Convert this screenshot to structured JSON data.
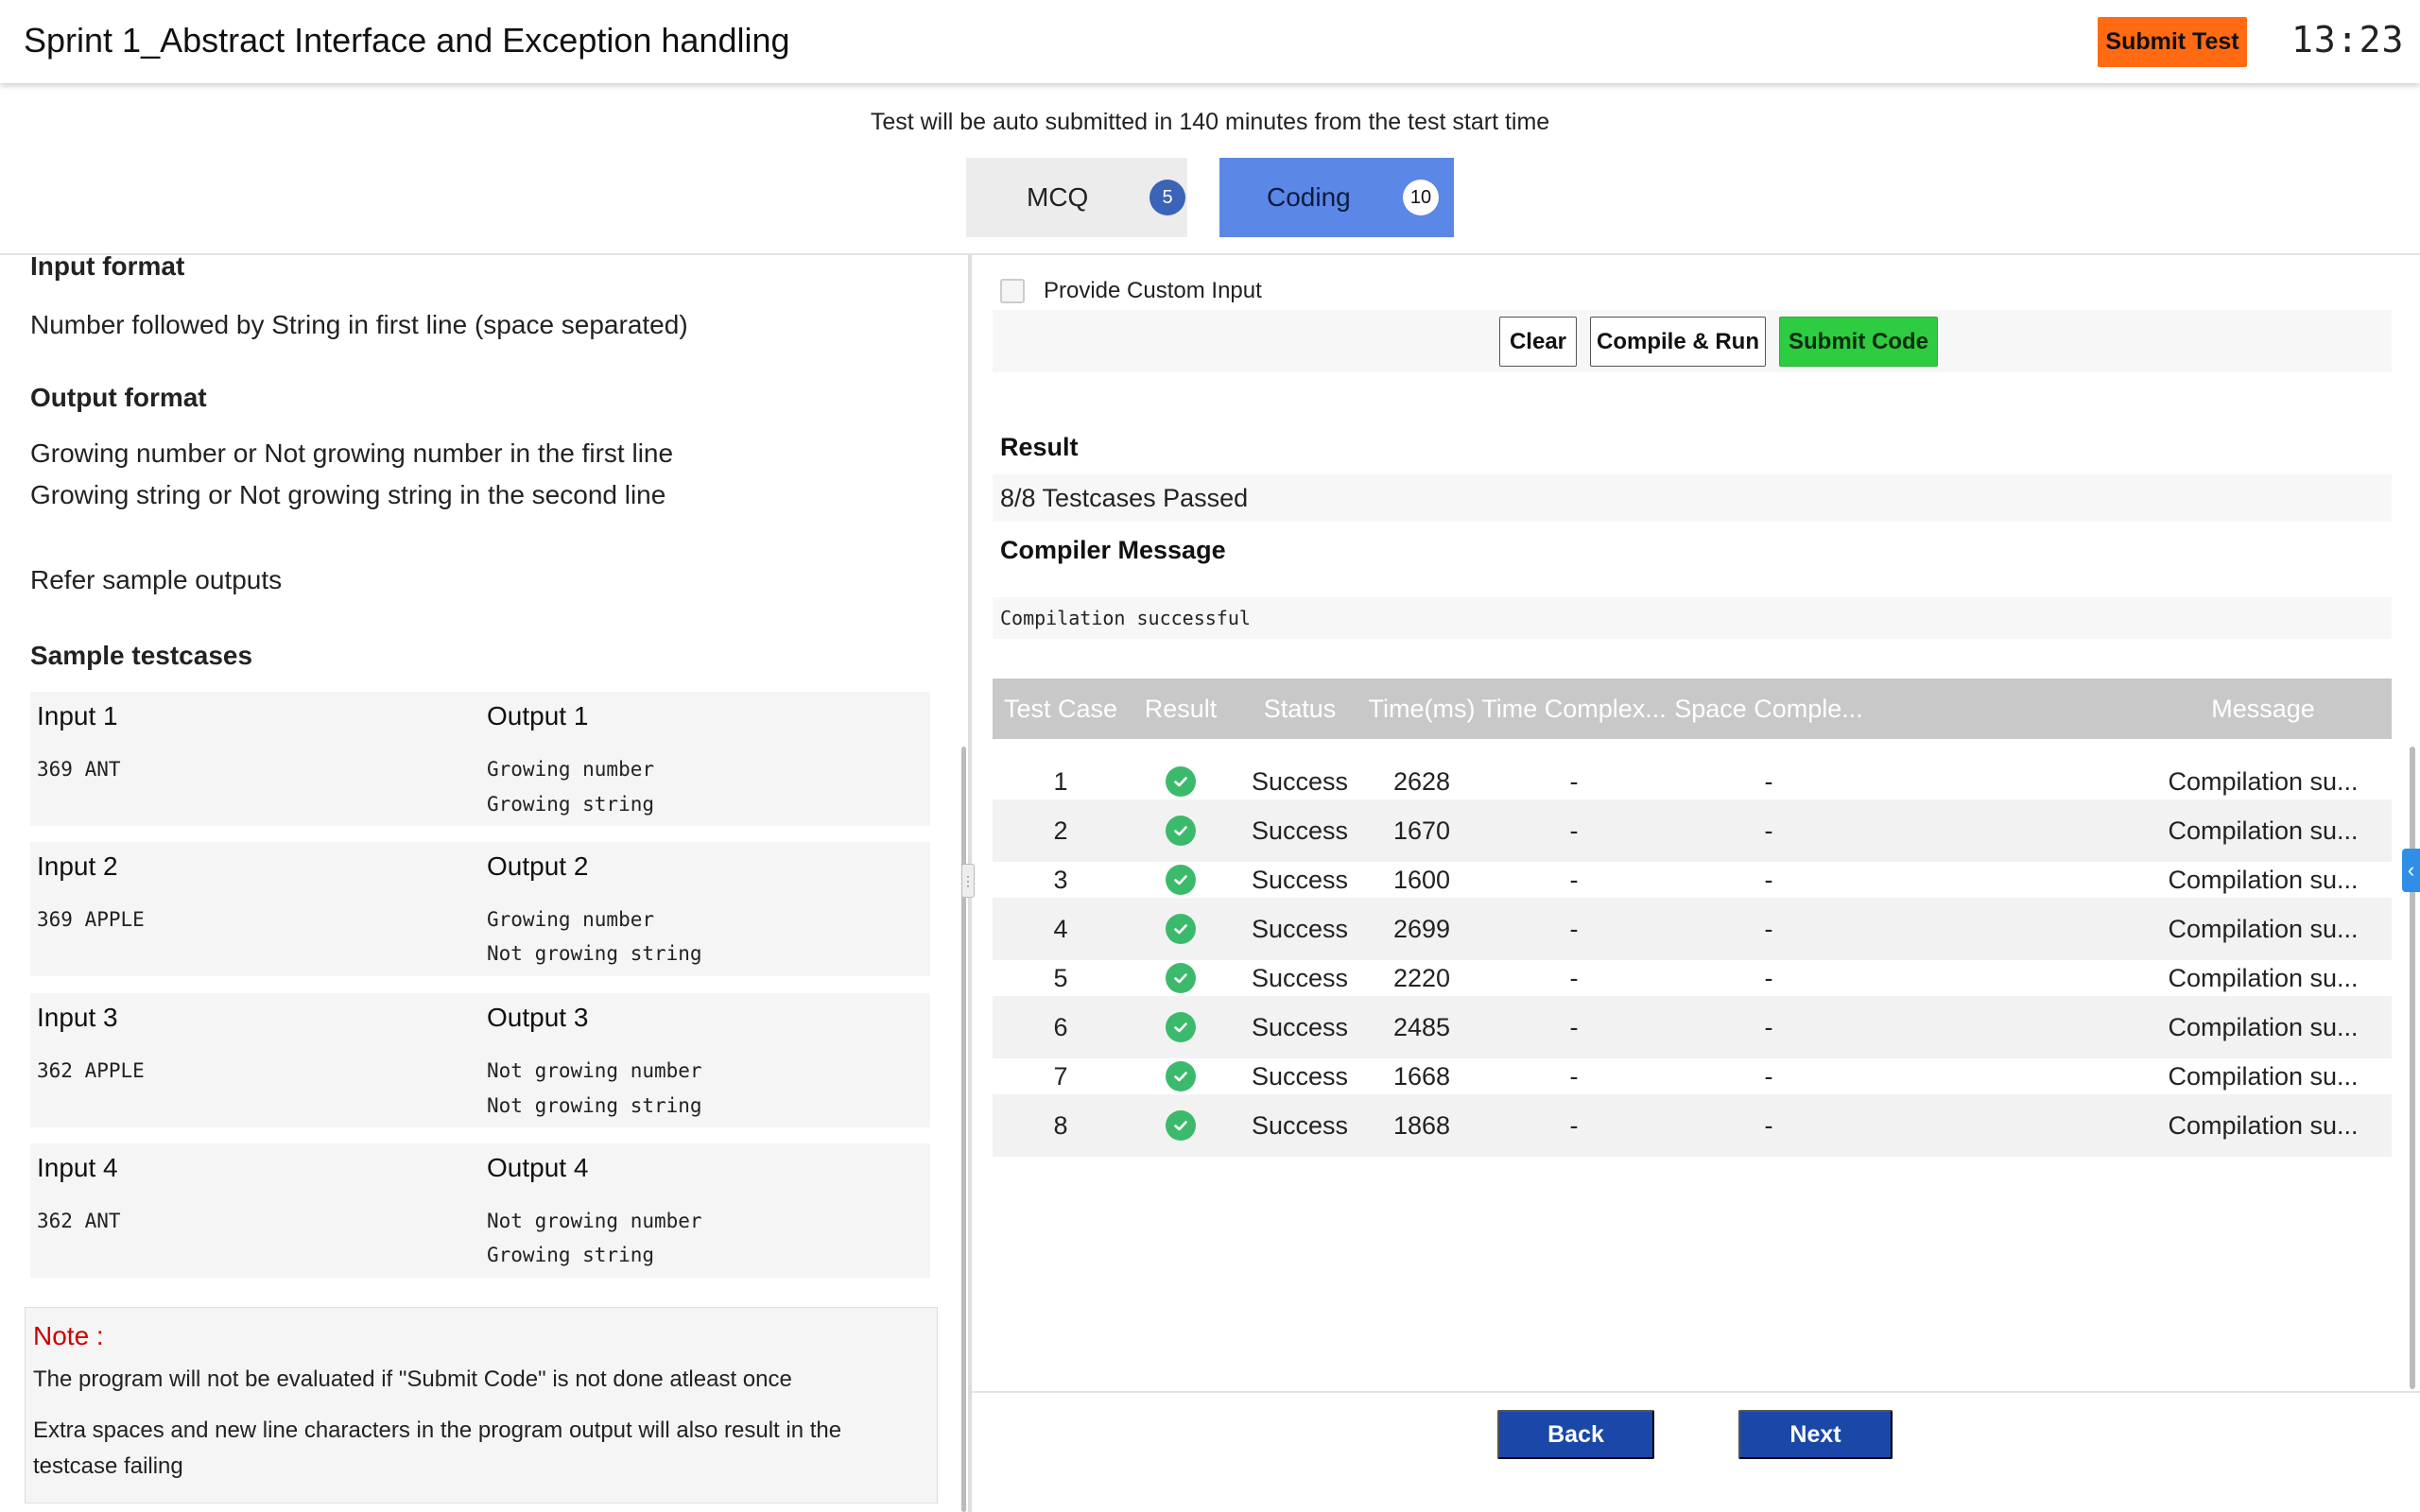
{
  "header": {
    "title": "Sprint 1_Abstract Interface and Exception handling",
    "submit_test_label": "Submit Test",
    "timer": "13:23",
    "accent_color": "#ff6a13"
  },
  "auto_submit_message": "Test will be auto submitted in 140 minutes from the test start time",
  "tabs": [
    {
      "label": "MCQ",
      "count": "5",
      "active": false
    },
    {
      "label": "Coding",
      "count": "10",
      "active": true
    }
  ],
  "problem": {
    "input_format_heading": "Input format",
    "input_format_text": "Number followed by String in first line (space separated)",
    "output_format_heading": "Output format",
    "output_format_lines": [
      "Growing number or Not growing number in the first line",
      "Growing string or Not growing string in the second line"
    ],
    "refer_text": "Refer sample outputs",
    "sample_heading": "Sample testcases",
    "samples": [
      {
        "input_label": "Input 1",
        "input": "369 ANT",
        "output_label": "Output 1",
        "output": [
          "Growing number",
          "Growing string"
        ]
      },
      {
        "input_label": "Input 2",
        "input": "369 APPLE",
        "output_label": "Output 2",
        "output": [
          "Growing number",
          "Not growing string"
        ]
      },
      {
        "input_label": "Input 3",
        "input": "362 APPLE",
        "output_label": "Output 3",
        "output": [
          "Not growing number",
          "Not growing string"
        ]
      },
      {
        "input_label": "Input 4",
        "input": "362 ANT",
        "output_label": "Output 4",
        "output": [
          "Not growing number",
          "Growing string"
        ]
      }
    ],
    "note": {
      "label": "Note :",
      "line1": "The program will not be evaluated if \"Submit Code\" is not done atleast once",
      "line2a": "Extra spaces and new line characters in the program output will also result in the",
      "line2b": "testcase failing"
    }
  },
  "editor": {
    "custom_input_label": "Provide Custom Input",
    "clear_label": "Clear",
    "compile_label": "Compile & Run",
    "submit_code_label": "Submit Code",
    "result_heading": "Result",
    "result_value": "8/8 Testcases Passed",
    "compiler_heading": "Compiler Message",
    "compiler_value": "Compilation successful"
  },
  "results_table": {
    "headers": [
      "Test Case",
      "Result",
      "Status",
      "Time(ms)",
      "Time Complex...",
      "Space Comple...",
      "Message"
    ],
    "rows": [
      {
        "case": "1",
        "status": "Success",
        "time": "2628",
        "time_c": "-",
        "space_c": "-",
        "message": "Compilation su..."
      },
      {
        "case": "2",
        "status": "Success",
        "time": "1670",
        "time_c": "-",
        "space_c": "-",
        "message": "Compilation su..."
      },
      {
        "case": "3",
        "status": "Success",
        "time": "1600",
        "time_c": "-",
        "space_c": "-",
        "message": "Compilation su..."
      },
      {
        "case": "4",
        "status": "Success",
        "time": "2699",
        "time_c": "-",
        "space_c": "-",
        "message": "Compilation su..."
      },
      {
        "case": "5",
        "status": "Success",
        "time": "2220",
        "time_c": "-",
        "space_c": "-",
        "message": "Compilation su..."
      },
      {
        "case": "6",
        "status": "Success",
        "time": "2485",
        "time_c": "-",
        "space_c": "-",
        "message": "Compilation su..."
      },
      {
        "case": "7",
        "status": "Success",
        "time": "1668",
        "time_c": "-",
        "space_c": "-",
        "message": "Compilation su..."
      },
      {
        "case": "8",
        "status": "Success",
        "time": "1868",
        "time_c": "-",
        "space_c": "-",
        "message": "Compilation su..."
      }
    ]
  },
  "nav": {
    "back_label": "Back",
    "next_label": "Next"
  }
}
